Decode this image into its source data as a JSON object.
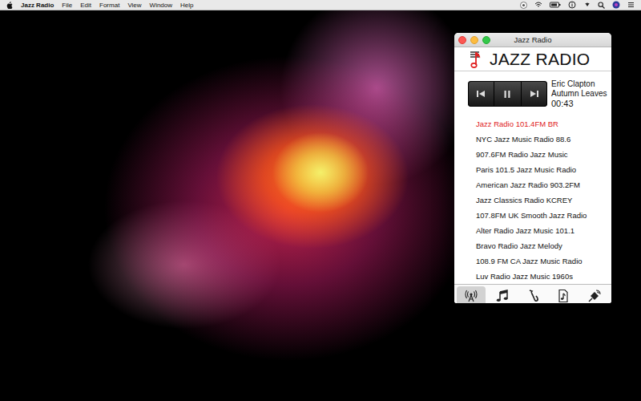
{
  "menubar": {
    "app": "Jazz Radio",
    "items": [
      "File",
      "Edit",
      "Format",
      "View",
      "Window",
      "Help"
    ]
  },
  "window": {
    "title": "Jazz Radio"
  },
  "logo": {
    "text": "JAZZ RADIO"
  },
  "player": {
    "artist": "Eric Clapton",
    "track": "Autumn Leaves",
    "time": "00:43",
    "playing": true
  },
  "stations": [
    {
      "name": "Jazz Radio 101.4FM BR",
      "selected": true
    },
    {
      "name": "NYC Jazz Music Radio 88.6",
      "selected": false
    },
    {
      "name": "907.6FM Radio Jazz Music",
      "selected": false
    },
    {
      "name": "Paris 101.5 Jazz Music Radio",
      "selected": false
    },
    {
      "name": "American Jazz Radio 903.2FM",
      "selected": false
    },
    {
      "name": "Jazz Classics Radio KCREY",
      "selected": false
    },
    {
      "name": "107.8FM UK Smooth Jazz Radio",
      "selected": false
    },
    {
      "name": "Alter Radio Jazz Music 101.1",
      "selected": false
    },
    {
      "name": "Bravo Radio Jazz Melody",
      "selected": false
    },
    {
      "name": "108.9 FM CA Jazz Music Radio",
      "selected": false
    },
    {
      "name": "Luv Radio Jazz Music 1960s",
      "selected": false
    }
  ],
  "toolbar": [
    {
      "kind": "radio",
      "selected": true
    },
    {
      "kind": "music",
      "selected": false
    },
    {
      "kind": "sax",
      "selected": false
    },
    {
      "kind": "file",
      "selected": false
    },
    {
      "kind": "satellite",
      "selected": false
    }
  ]
}
